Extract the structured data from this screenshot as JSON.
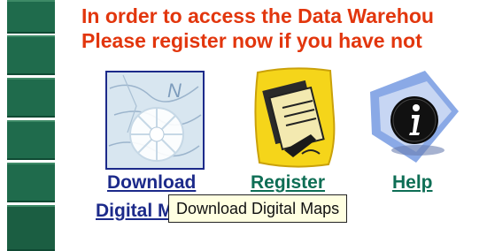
{
  "heading": {
    "line1": "In order to access the Data Warehou",
    "line2": "Please register now if you have not"
  },
  "links": {
    "download": {
      "label_line1": "Download",
      "label_line2": "Digital M",
      "icon": "compass-map-icon"
    },
    "register": {
      "label": "Register",
      "icon": "register-form-icon"
    },
    "help": {
      "label": "Help",
      "icon": "info-icon"
    }
  },
  "tooltip": {
    "text": "Download Digital Maps"
  },
  "colors": {
    "heading": "#e2360d",
    "sidebar": "#1f6b4c",
    "link_download": "#1c2a8a",
    "link_other": "#0e6e55",
    "tooltip_bg": "#ffffe1"
  }
}
